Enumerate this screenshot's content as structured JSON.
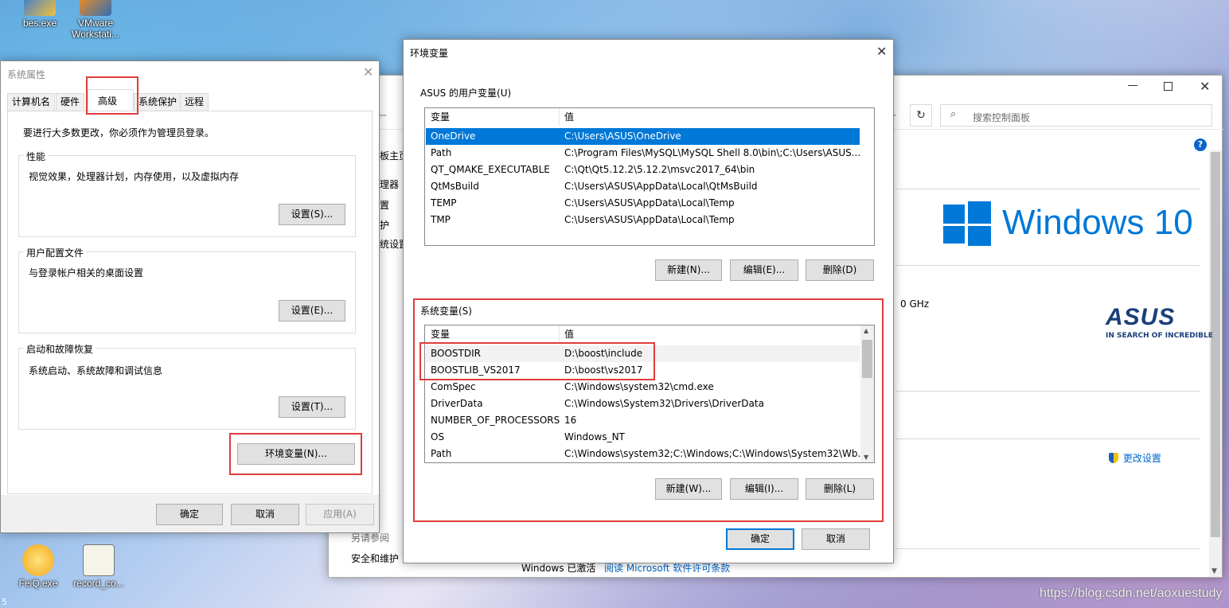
{
  "desktop": {
    "icons": [
      {
        "label": "bes.exe"
      },
      {
        "label": "VMware Workstati..."
      },
      {
        "label": "FeiQ.exe"
      },
      {
        "label": "record_co..."
      }
    ],
    "watermark": "https://blog.csdn.net/aoxuestudy",
    "corner_digit": "5"
  },
  "control_panel": {
    "search_placeholder": "搜索控制面板",
    "left_links": [
      "板主页",
      "理器",
      "置",
      "护",
      "统设置"
    ],
    "windows_brand": "Windows 10",
    "asus_brand": "ASUS",
    "asus_tagline": "IN SEARCH OF INCREDIBLE",
    "ghz_fragment": "0 GHz",
    "change_settings": "更改设置",
    "see_also": "另请参阅",
    "security": "安全和维护",
    "activation_text": "Windows 已激活",
    "license_link": "阅读 Microsoft 软件许可条款"
  },
  "sys_props": {
    "title": "系统属性",
    "tabs": [
      "计算机名",
      "硬件",
      "高级",
      "系统保护",
      "远程"
    ],
    "admin_note": "要进行大多数更改，你必须作为管理员登录。",
    "performance": {
      "label": "性能",
      "desc": "视觉效果，处理器计划，内存使用，以及虚拟内存",
      "button": "设置(S)..."
    },
    "profiles": {
      "label": "用户配置文件",
      "desc": "与登录帐户相关的桌面设置",
      "button": "设置(E)..."
    },
    "startup": {
      "label": "启动和故障恢复",
      "desc": "系统启动、系统故障和调试信息",
      "button": "设置(T)..."
    },
    "env_button": "环境变量(N)...",
    "ok": "确定",
    "cancel": "取消",
    "apply": "应用(A)"
  },
  "env_vars": {
    "title": "环境变量",
    "user_section": "ASUS 的用户变量(U)",
    "col_var": "变量",
    "col_val": "值",
    "user_vars": [
      {
        "name": "OneDrive",
        "value": "C:\\Users\\ASUS\\OneDrive"
      },
      {
        "name": "Path",
        "value": "C:\\Program Files\\MySQL\\MySQL Shell 8.0\\bin\\;C:\\Users\\ASUS..."
      },
      {
        "name": "QT_QMAKE_EXECUTABLE",
        "value": "C:\\Qt\\Qt5.12.2\\5.12.2\\msvc2017_64\\bin"
      },
      {
        "name": "QtMsBuild",
        "value": "C:\\Users\\ASUS\\AppData\\Local\\QtMsBuild"
      },
      {
        "name": "TEMP",
        "value": "C:\\Users\\ASUS\\AppData\\Local\\Temp"
      },
      {
        "name": "TMP",
        "value": "C:\\Users\\ASUS\\AppData\\Local\\Temp"
      }
    ],
    "user_buttons": {
      "new": "新建(N)...",
      "edit": "编辑(E)...",
      "delete": "删除(D)"
    },
    "system_section": "系统变量(S)",
    "system_vars": [
      {
        "name": "BOOSTDIR",
        "value": "D:\\boost\\include"
      },
      {
        "name": "BOOSTLIB_VS2017",
        "value": "D:\\boost\\vs2017"
      },
      {
        "name": "ComSpec",
        "value": "C:\\Windows\\system32\\cmd.exe"
      },
      {
        "name": "DriverData",
        "value": "C:\\Windows\\System32\\Drivers\\DriverData"
      },
      {
        "name": "NUMBER_OF_PROCESSORS",
        "value": "16"
      },
      {
        "name": "OS",
        "value": "Windows_NT"
      },
      {
        "name": "Path",
        "value": "C:\\Windows\\system32;C:\\Windows;C:\\Windows\\System32\\Wb..."
      }
    ],
    "system_buttons": {
      "new": "新建(W)...",
      "edit": "编辑(I)...",
      "delete": "删除(L)"
    },
    "ok": "确定",
    "cancel": "取消"
  },
  "colors": {
    "accent": "#0078d7",
    "highlight_box": "#e03c3c",
    "windows_blue": "#0078d7",
    "asus_navy": "#1a3f7a"
  }
}
